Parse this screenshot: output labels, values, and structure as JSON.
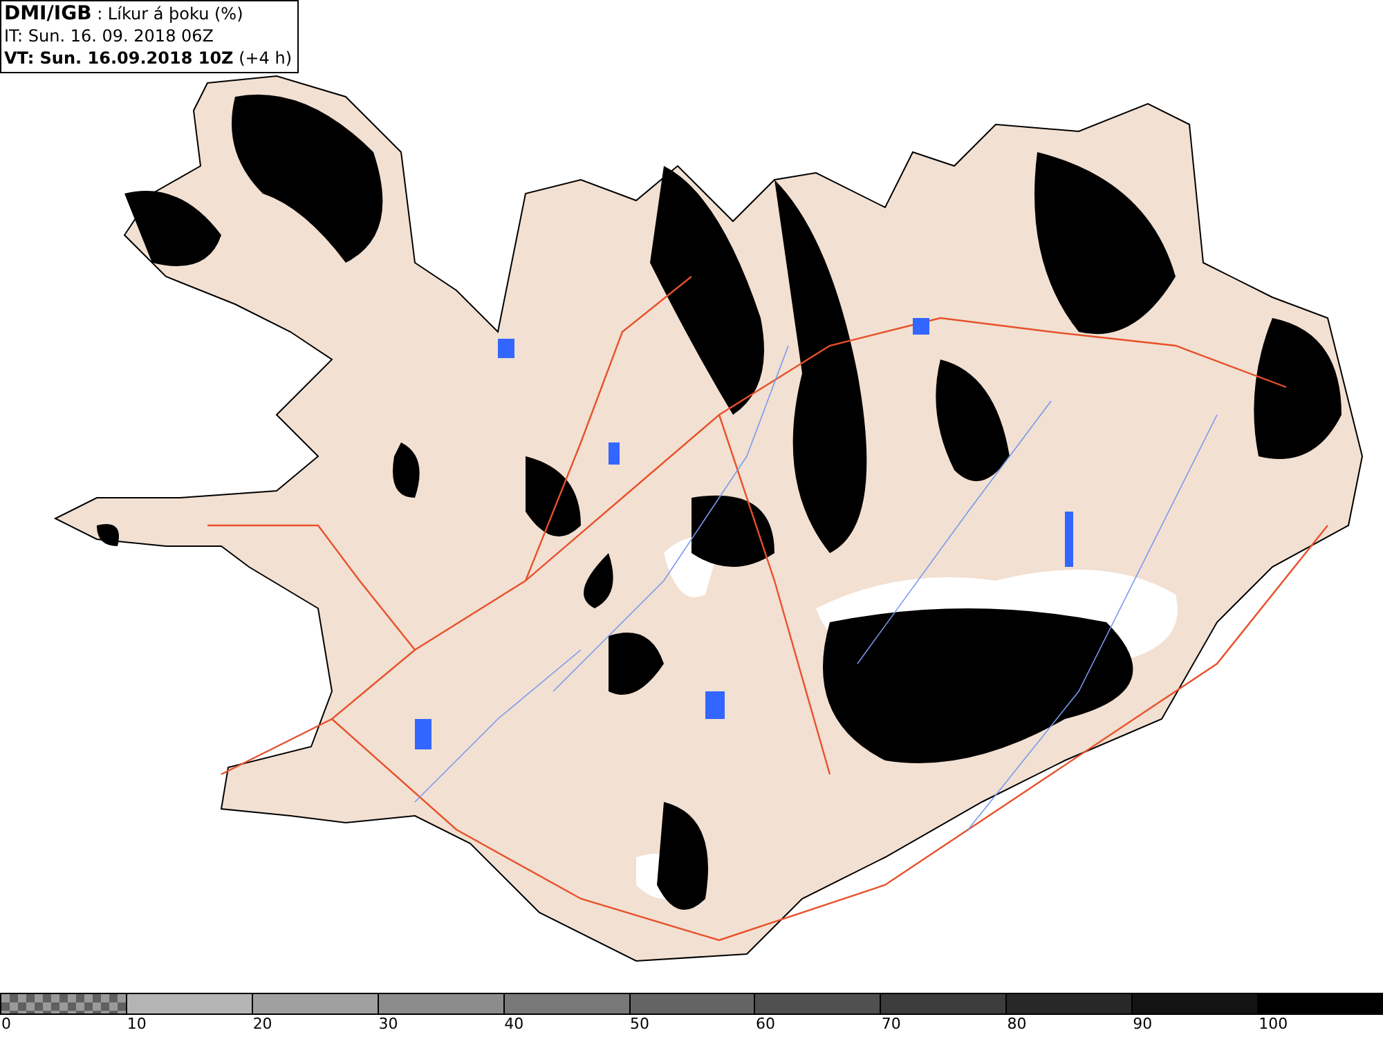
{
  "header": {
    "title": "**DMI/IGB** : Líkur á þoku (%)",
    "initial_time": "IT: Sun. 16. 09. 2018 06Z",
    "valid_time": "**VT: Sun. 16.09.2018 10Z** (+4 h)"
  },
  "legend": [
    {
      "label": "0",
      "color": "#606060",
      "kind": "checker"
    },
    {
      "label": "10",
      "color": "#b4b4b4",
      "kind": "solid"
    },
    {
      "label": "20",
      "color": "#a0a0a0",
      "kind": "solid"
    },
    {
      "label": "30",
      "color": "#8c8c8c",
      "kind": "solid"
    },
    {
      "label": "40",
      "color": "#787878",
      "kind": "solid"
    },
    {
      "label": "50",
      "color": "#646464",
      "kind": "solid"
    },
    {
      "label": "60",
      "color": "#505050",
      "kind": "solid"
    },
    {
      "label": "70",
      "color": "#3c3c3c",
      "kind": "solid"
    },
    {
      "label": "80",
      "color": "#282828",
      "kind": "solid"
    },
    {
      "label": "90",
      "color": "#141414",
      "kind": "solid"
    },
    {
      "label": "100",
      "color": "#000000",
      "kind": "solid"
    }
  ]
}
